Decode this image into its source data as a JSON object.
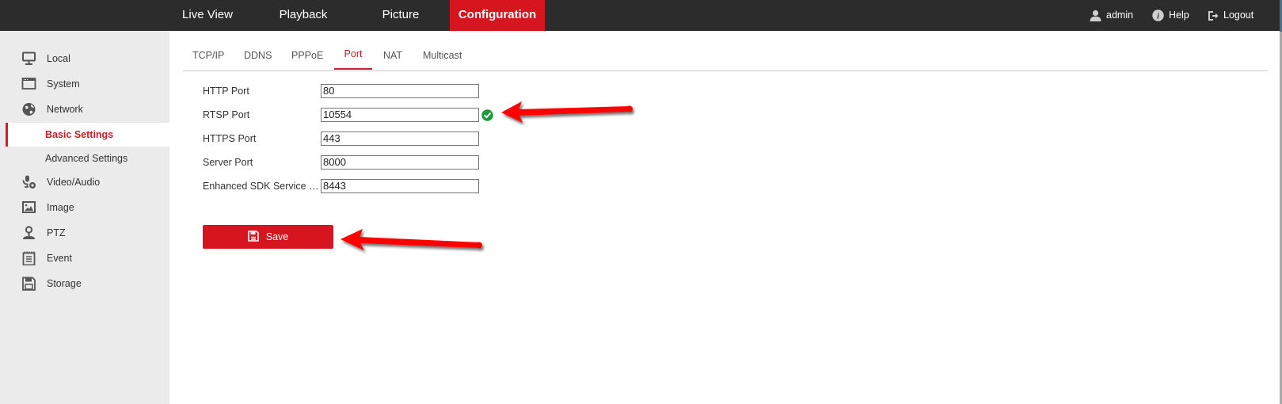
{
  "topbar": {
    "nav": [
      {
        "label": "Live View",
        "active": false
      },
      {
        "label": "Playback",
        "active": false
      },
      {
        "label": "Picture",
        "active": false
      },
      {
        "label": "Configuration",
        "active": true
      }
    ],
    "user": {
      "icon": "user-icon",
      "label": "admin"
    },
    "help": {
      "icon": "info-icon",
      "label": "Help"
    },
    "logout": {
      "icon": "logout-icon",
      "label": "Logout"
    }
  },
  "sidebar": {
    "items": [
      {
        "label": "Local",
        "icon": "monitor-icon"
      },
      {
        "label": "System",
        "icon": "window-icon"
      },
      {
        "label": "Network",
        "icon": "globe-icon"
      },
      {
        "label": "Basic Settings",
        "sub": true,
        "active": true
      },
      {
        "label": "Advanced Settings",
        "sub": true,
        "active": false
      },
      {
        "label": "Video/Audio",
        "icon": "microphone-icon"
      },
      {
        "label": "Image",
        "icon": "image-icon"
      },
      {
        "label": "PTZ",
        "icon": "ptz-camera-icon"
      },
      {
        "label": "Event",
        "icon": "notepad-icon"
      },
      {
        "label": "Storage",
        "icon": "floppy-disk-icon"
      }
    ]
  },
  "tabs": [
    {
      "label": "TCP/IP",
      "active": false
    },
    {
      "label": "DDNS",
      "active": false
    },
    {
      "label": "PPPoE",
      "active": false
    },
    {
      "label": "Port",
      "active": true
    },
    {
      "label": "NAT",
      "active": false
    },
    {
      "label": "Multicast",
      "active": false
    }
  ],
  "form": {
    "fields": [
      {
        "label": "HTTP Port",
        "value": "80"
      },
      {
        "label": "RTSP Port",
        "value": "10554",
        "status": "valid"
      },
      {
        "label": "HTTPS Port",
        "value": "443"
      },
      {
        "label": "Server Port",
        "value": "8000"
      },
      {
        "label": "Enhanced SDK Service Port",
        "value": "8443"
      }
    ],
    "save_label": "Save"
  },
  "colors": {
    "accent": "#d7151f",
    "topbar": "#2c2c2c",
    "sidebar": "#ebebeb",
    "valid": "#1a9a3a",
    "annotation_arrow": "#ff0000"
  }
}
